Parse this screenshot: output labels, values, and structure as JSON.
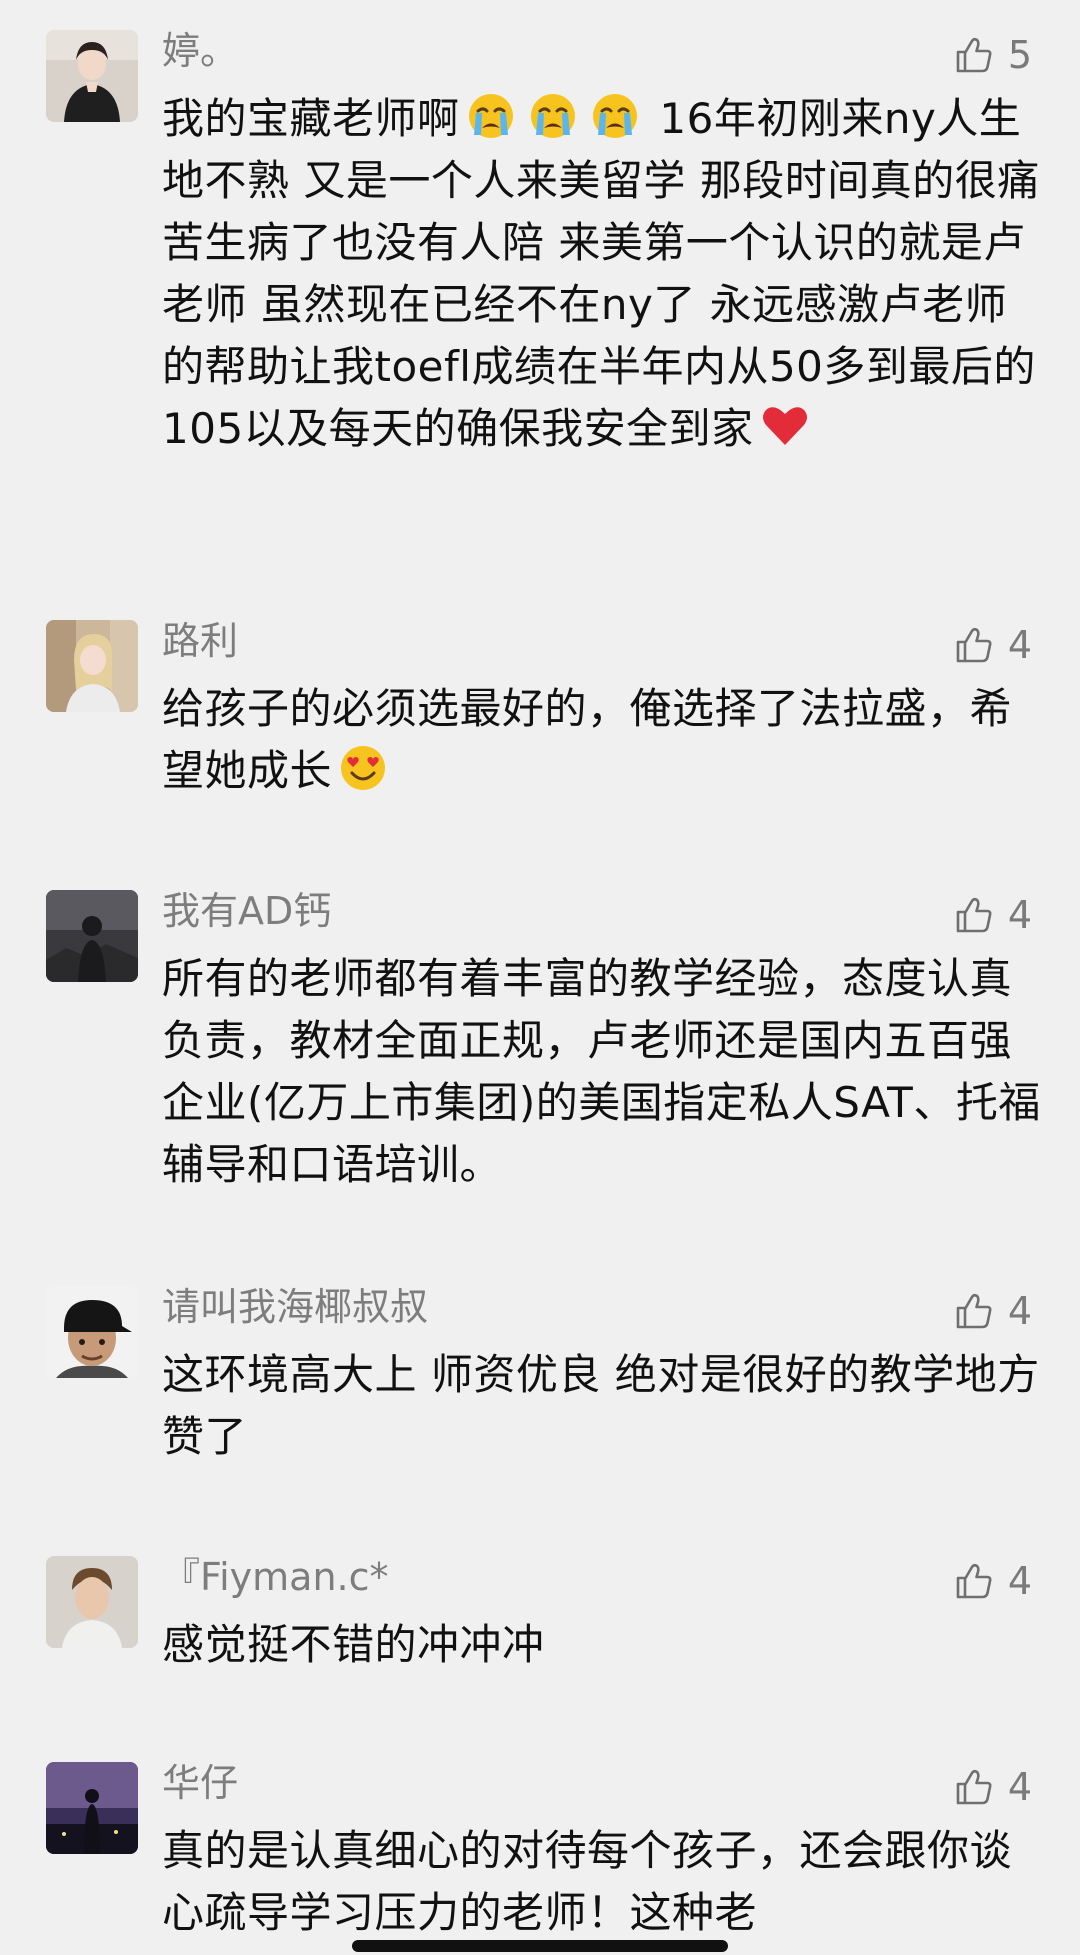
{
  "comments": [
    {
      "author": "婷。",
      "likes": "5",
      "text_parts": [
        "我的宝藏老师啊",
        "16年初刚来ny人生地不熟 又是一个人来美留学 那段时间真的很痛苦生病了也没有人陪 来美第一个认识的就是卢老师 虽然现在已经不在ny了 永远感激卢老师的帮助让我toefl成绩在半年内从50多到最后的105以及每天的确保我安全到家"
      ],
      "emojis": [
        "crying-face",
        "crying-face",
        "crying-face",
        "red-heart"
      ]
    },
    {
      "author": "路利",
      "likes": "4",
      "text": "给孩子的必须选最好的，俺选择了法拉盛，希望她成长",
      "emojis": [
        "heart-eyes-face"
      ]
    },
    {
      "author": "我有AD钙",
      "likes": "4",
      "text": "所有的老师都有着丰富的教学经验，态度认真负责，教材全面正规，卢老师还是国内五百强企业(亿万上市集团)的美国指定私人SAT、托福辅导和口语培训。"
    },
    {
      "author": "请叫我海椰叔叔",
      "likes": "4",
      "text": "这环境高大上 师资优良 绝对是很好的教学地方 赞了"
    },
    {
      "author": "『Fiyman.c*",
      "likes": "4",
      "text": "感觉挺不错的冲冲冲"
    },
    {
      "author": "华仔",
      "likes": "4",
      "text": "真的是认真细心的对待每个孩子，还会跟你谈心疏导学习压力的老师！这种老"
    }
  ],
  "icons": {
    "like": "thumbs-up-outline-icon"
  },
  "colors": {
    "background": "#f0f0f0",
    "author": "#7d7d7d",
    "text": "#111111",
    "like_icon": "#6f6f6f"
  }
}
